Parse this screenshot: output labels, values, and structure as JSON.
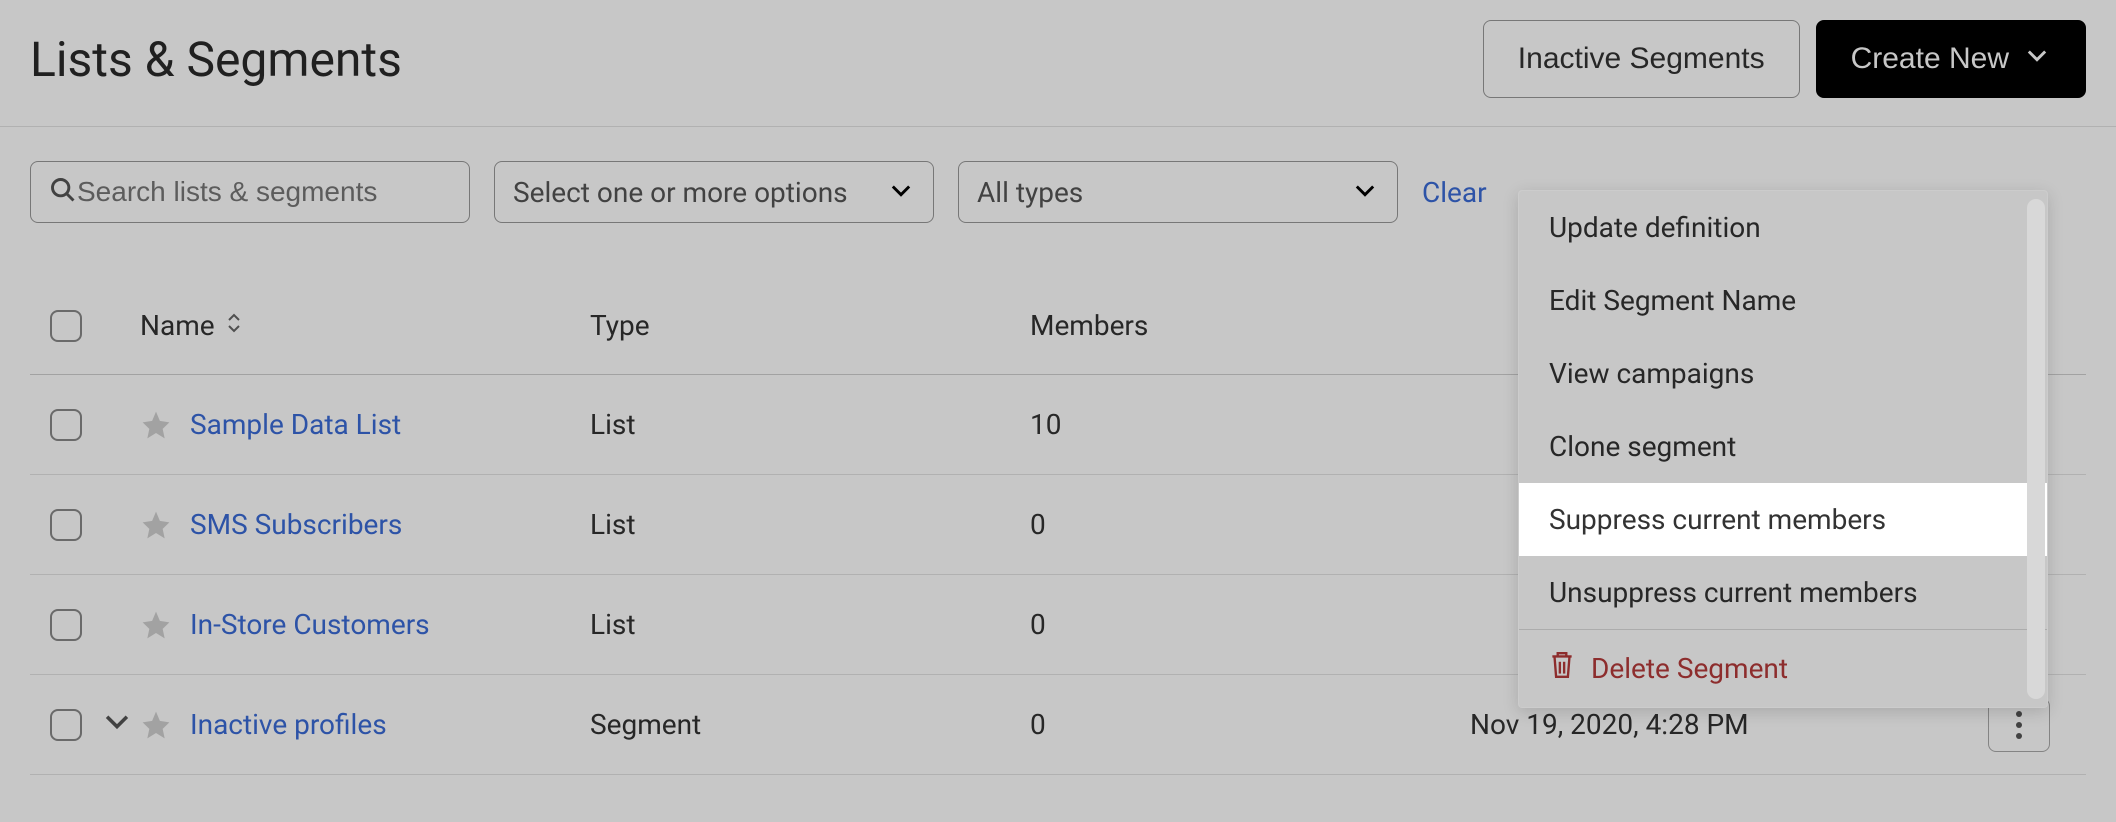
{
  "header": {
    "title": "Lists & Segments",
    "inactive_button": "Inactive Segments",
    "create_button": "Create New"
  },
  "filters": {
    "search_placeholder": "Search lists & segments",
    "options_select": "Select one or more options",
    "types_select": "All types",
    "clear": "Clear"
  },
  "table": {
    "columns": {
      "name": "Name",
      "type": "Type",
      "members": "Members",
      "created": ""
    },
    "rows": [
      {
        "name": "Sample Data List",
        "type": "List",
        "members": "10",
        "created": "",
        "expandable": false,
        "kebab": false
      },
      {
        "name": "SMS Subscribers",
        "type": "List",
        "members": "0",
        "created": "",
        "expandable": false,
        "kebab": false
      },
      {
        "name": "In-Store Customers",
        "type": "List",
        "members": "0",
        "created": "",
        "expandable": false,
        "kebab": false
      },
      {
        "name": "Inactive profiles",
        "type": "Segment",
        "members": "0",
        "created": "Nov 19, 2020, 4:28 PM",
        "expandable": true,
        "kebab": true
      }
    ]
  },
  "dropdown": {
    "items": [
      {
        "label": "Update definition",
        "highlight": false,
        "danger": false
      },
      {
        "label": "Edit Segment Name",
        "highlight": false,
        "danger": false
      },
      {
        "label": "View campaigns",
        "highlight": false,
        "danger": false
      },
      {
        "label": "Clone segment",
        "highlight": false,
        "danger": false
      },
      {
        "label": "Suppress current members",
        "highlight": true,
        "danger": false
      },
      {
        "label": "Unsuppress current members",
        "highlight": false,
        "danger": false
      },
      {
        "label": "Delete Segment",
        "highlight": false,
        "danger": true
      }
    ]
  }
}
